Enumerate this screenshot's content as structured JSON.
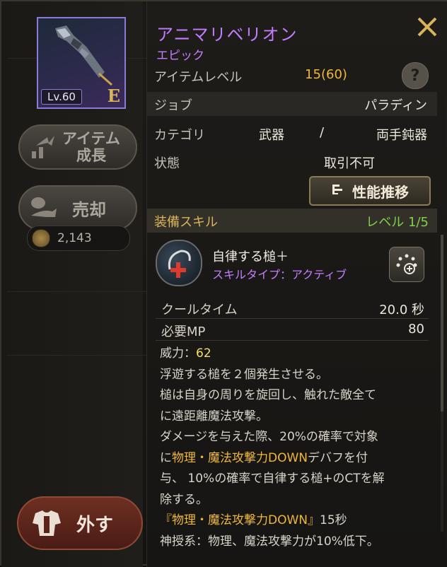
{
  "item": {
    "name": "アニマリベリオン",
    "grade": "エピック",
    "level_badge": "Lv.60",
    "grade_letter": "E",
    "item_level_label": "アイテムレベル",
    "item_level_value": "15",
    "item_level_max": "(60)",
    "job_label": "ジョブ",
    "job_value": "パラディン",
    "category_label": "カテゴリ",
    "category_value1": "武器",
    "category_sep": "/",
    "category_value2": "両手鈍器",
    "state_label": "状態",
    "state_value": "取引不可"
  },
  "buttons": {
    "help": "?",
    "performance": "性能推移",
    "growth_line1": "アイテム",
    "growth_line2": "成長",
    "sell": "売却",
    "unequip": "外す"
  },
  "gold": "2,143",
  "skill": {
    "header": "装備スキル",
    "level": "レベル 1/5",
    "name": "自律する槌＋",
    "type": "スキルタイプ：アクティブ",
    "cooltime_label": "クールタイム",
    "cooltime_value": "20.0 秒",
    "mp_label": "必要MP",
    "mp_value": "80",
    "power_label": "威力：",
    "power_value": "62",
    "line1": "浮遊する槌を２個発生させる。",
    "line2": "槌は自身の周りを旋回し、触れた敵全て",
    "line3": "に遠距離魔法攻撃。",
    "line4": "ダメージを与えた際、20%の確率で対象",
    "line5a": "に",
    "line5b": "物理・魔法攻撃力DOWN",
    "line5c": "デバフを付",
    "line6": "与、 10%の確率で自律する槌+のCTを解",
    "line7": "除する。",
    "line8a": "『物理・魔法攻撃力DOWN』",
    "line8b": "15秒",
    "line9": "神授系：物理、魔法攻撃力が10%低下。"
  },
  "colors": {
    "epic": "#c27dff",
    "level_green": "#7fd14a",
    "highlight": "#f0b83a",
    "header_gold": "#d9b45a"
  },
  "icons": [
    "close-icon",
    "help-icon",
    "performance-icon",
    "growth-icon",
    "sell-icon",
    "coin-icon",
    "armor-icon",
    "skill-icon",
    "skill-detail-icon"
  ]
}
